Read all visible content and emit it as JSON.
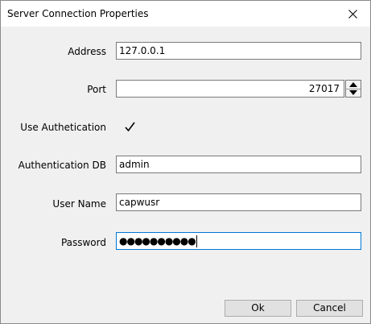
{
  "window": {
    "title": "Server Connection Properties"
  },
  "form": {
    "address": {
      "label": "Address",
      "value": "127.0.0.1"
    },
    "port": {
      "label": "Port",
      "value": "27017"
    },
    "use_auth": {
      "label": "Use Authetication",
      "checked": true
    },
    "auth_db": {
      "label": "Authentication DB",
      "value": "admin"
    },
    "user_name": {
      "label": "User Name",
      "value": "capwusr"
    },
    "password": {
      "label": "Password",
      "value": "●●●●●●●●●●"
    }
  },
  "buttons": {
    "ok_label": "Ok",
    "cancel_label": "Cancel"
  },
  "colors": {
    "window_bg": "#f0f0f0",
    "titlebar_bg": "#ffffff",
    "focus_border": "#0078d7",
    "field_border": "#7a7a7a",
    "button_bg": "#e1e1e1"
  }
}
